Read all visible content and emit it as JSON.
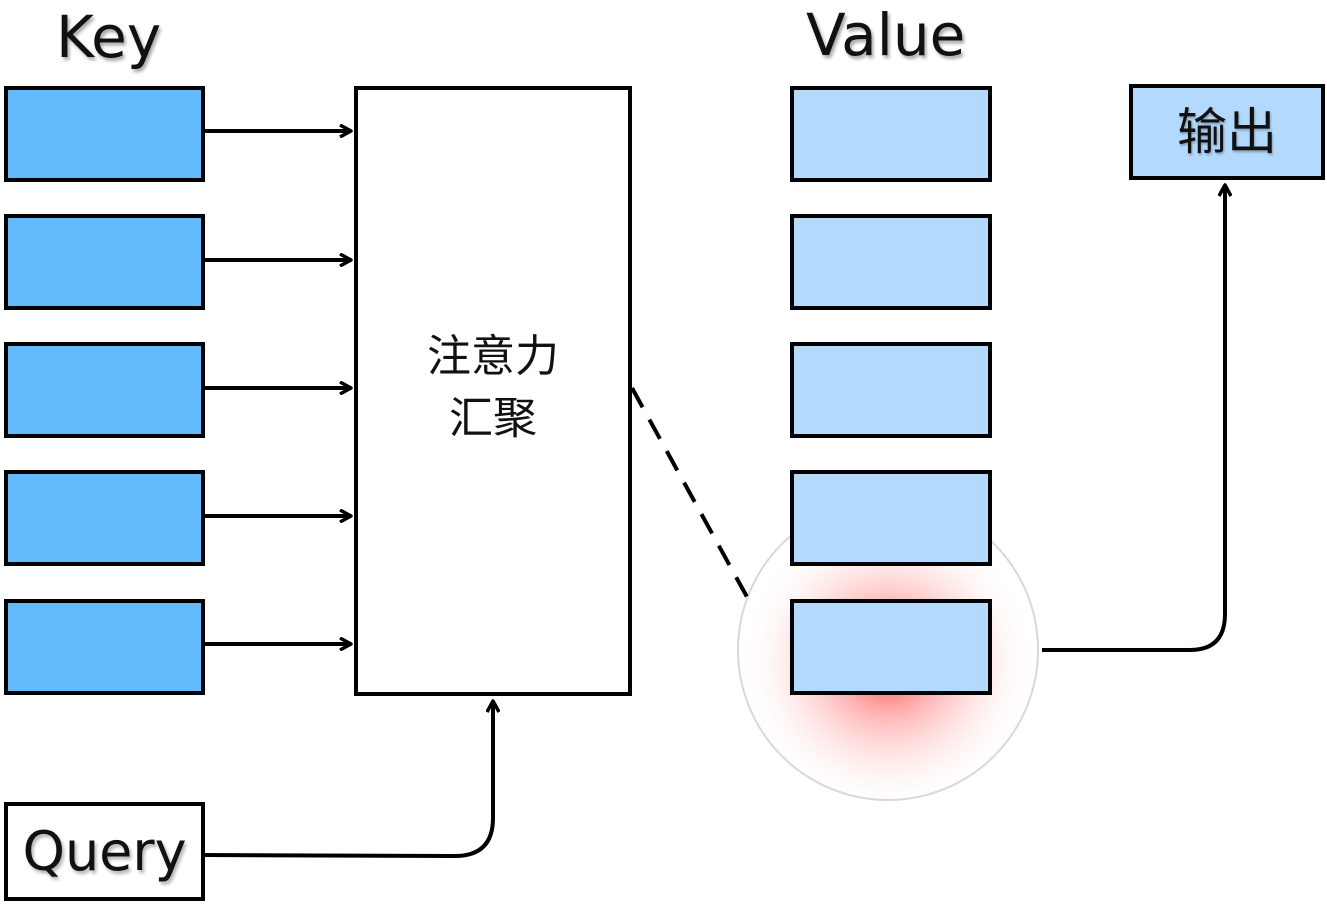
{
  "headings": {
    "key": "Key",
    "value": "Value"
  },
  "attention_pooling": {
    "line1": "注意力",
    "line2": "汇聚"
  },
  "output": {
    "label": "输出"
  },
  "query": {
    "label": "Query"
  },
  "colors": {
    "key_fill": "#63bbfe",
    "value_fill": "#b3d9fd",
    "highlight": "#ff3b3b",
    "stroke": "#000000"
  },
  "counts": {
    "keys": 5,
    "values": 5
  },
  "highlighted_value_index": 4
}
